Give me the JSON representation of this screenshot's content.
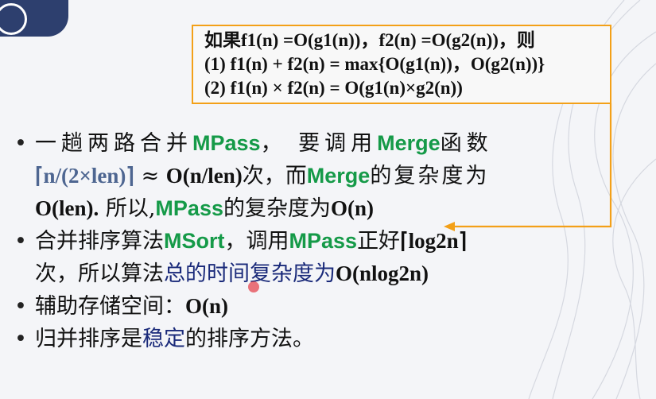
{
  "theorem": {
    "line1": "如果f1(n) =O(g1(n))，f2(n) =O(g2(n))，则",
    "line2": "(1) f1(n) + f2(n) = max{O(g1(n))，O(g2(n))}",
    "line3": "(2) f1(n) × f2(n) = O(g1(n)×g2(n))"
  },
  "bullets": [
    {
      "line1": {
        "a": "一趟两路合并",
        "b": "MPass",
        "c": "， 要调用",
        "d": "Merge",
        "e": "函数"
      },
      "line2": {
        "a": "⌈n/(2×len)⌉",
        "b": "≈",
        "c": "O(n/len)",
        "d": "次，而",
        "e": "Merge",
        "f": "的复杂度为"
      },
      "line3": {
        "a": "O(len).",
        "b": " 所以,",
        "c": "MPass",
        "d": "的复杂度为",
        "e": "O(n)"
      }
    },
    {
      "line1": {
        "a": "合并排序算法",
        "b": "MSort",
        "c": "，调用",
        "d": "MPass",
        "e": "正好",
        "f": "⌈log2n⌉"
      },
      "line2": {
        "a": "次，所以算法",
        "b": "总的时间复杂度为",
        "c": "O(nlog2n)"
      }
    },
    {
      "a": "辅助存储空间：",
      "b": "O(n)"
    },
    {
      "a": "归并排序是",
      "b": "稳定",
      "c": "的排序方法。"
    }
  ],
  "colors": {
    "green": "#159a48",
    "orange": "#f3a018",
    "navy": "#1a2a7a"
  }
}
